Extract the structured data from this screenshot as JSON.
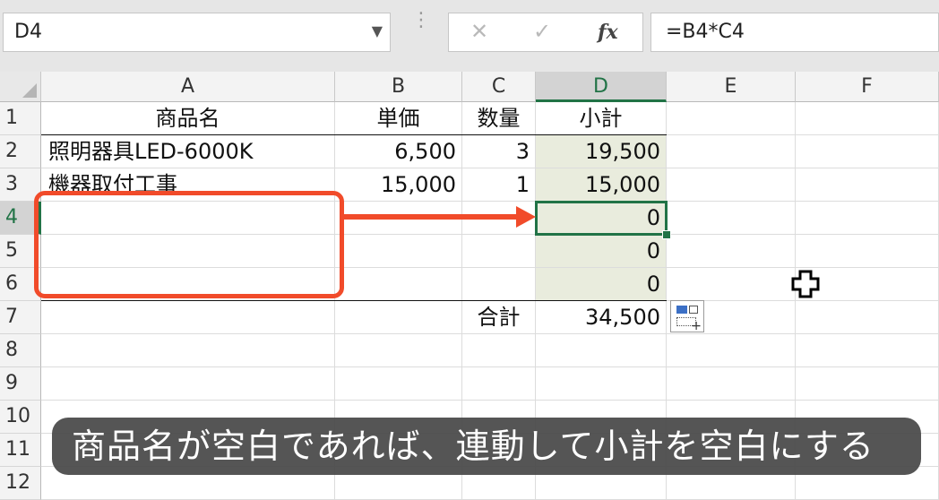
{
  "formula_bar": {
    "name_box": "D4",
    "name_box_dropdown": "▼",
    "separator": "⋮",
    "cancel_glyph": "✕",
    "enter_glyph": "✓",
    "fx_label": "fx",
    "formula": "=B4*C4"
  },
  "columns": [
    "A",
    "B",
    "C",
    "D",
    "E",
    "F"
  ],
  "rows": [
    "1",
    "2",
    "3",
    "4",
    "5",
    "6",
    "7",
    "8",
    "9",
    "10",
    "11",
    "12"
  ],
  "cells": {
    "A1": "商品名",
    "B1": "単価",
    "C1": "数量",
    "D1": "小計",
    "A2": "照明器具LED-6000K",
    "B2": "6,500",
    "C2": "3",
    "D2": "19,500",
    "A3": "機器取付工事",
    "B3": "15,000",
    "C3": "1",
    "D3": "15,000",
    "D4": "0",
    "D5": "0",
    "D6": "0",
    "C7": "合計",
    "D7": "34,500"
  },
  "selection": {
    "active_cell": "D4",
    "column": "D",
    "row": "4"
  },
  "annotation_color": "#f14b2a",
  "selection_color": "#217346",
  "caption": "商品名が空白であれば、連動して小計を空白にする"
}
